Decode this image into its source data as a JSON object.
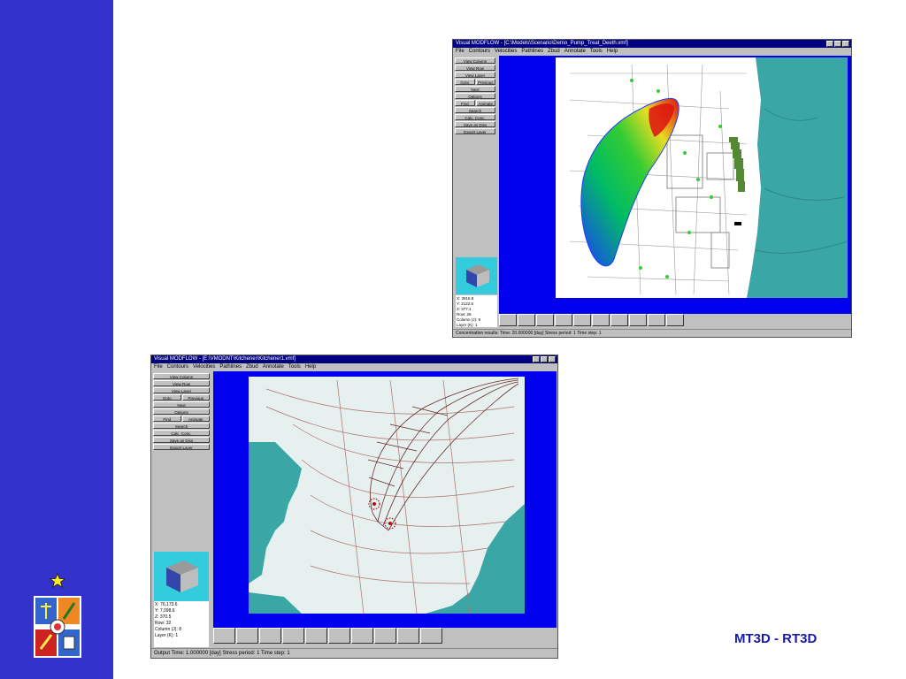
{
  "caption": "MT3D - RT3D",
  "window1": {
    "title": "Visual MODFLOW - [C:\\Models\\Scenario\\Demo_Pump_Treat_Deeth.vmf]",
    "menu": [
      "File",
      "Contours",
      "Velocities",
      "Pathlines",
      "Zbud",
      "Annotate",
      "Tools",
      "Help"
    ],
    "panel_buttons": [
      "View Column",
      "View Row",
      "View Layer",
      "Goto",
      "Previous",
      "Next",
      "Options",
      "Find",
      "Animate",
      "Search",
      "Calc. Conc.",
      "Save as Diss",
      "Export Layer"
    ],
    "readout": [
      "X: 3916.8",
      "Y: 2122.5",
      "Z: 377.1",
      "Row: 26",
      "Column (J): 8",
      "Layer (K): 1"
    ],
    "status": "Concentration results: Time: 20.000000 [day]  Stress period: 1  Time step: 1"
  },
  "window2": {
    "title": "Visual MODFLOW - [E:\\VMODNT\\Kitchener\\Kitchener1.vmf]",
    "menu": [
      "File",
      "Contours",
      "Velocities",
      "Pathlines",
      "Zbud",
      "Annotate",
      "Tools",
      "Help"
    ],
    "panel_buttons": [
      "View Column",
      "View Row",
      "View Layer",
      "Goto",
      "Previous",
      "Next",
      "Options",
      "Find",
      "Animate",
      "Search",
      "Calc. Conc.",
      "Save as Diss",
      "Export Layer"
    ],
    "readout": [
      "X: 76,173.6",
      "Y: 7,098.6",
      "Z: 370.5",
      "Row: 32",
      "Column (J): 8",
      "Layer (K): 1"
    ],
    "status": "Output Time: 1.000000 [day]  Stress period: 1  Time step: 1"
  },
  "colors": {
    "sidebar": "#3333cc",
    "viewport_frame": "#0000ee",
    "water": "#3aa6a6",
    "land": "#e6f0ef",
    "caption": "#1a1aa6"
  },
  "icons": [
    "star-icon",
    "university-crest-icon",
    "cube-3d-icon"
  ]
}
